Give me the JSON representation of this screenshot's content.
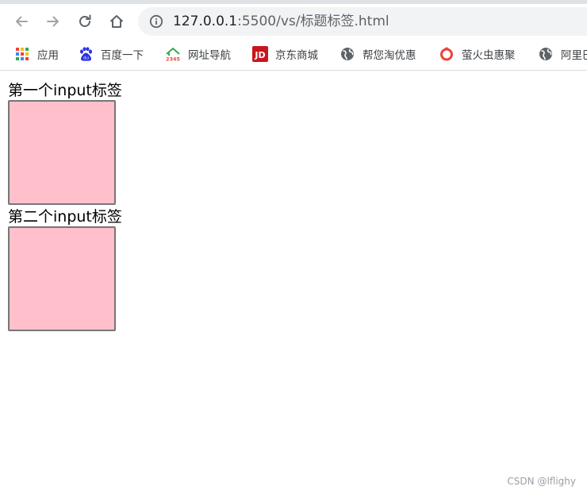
{
  "browser": {
    "url_host": "127.0.0.1",
    "url_path": ":5500/vs/标题标签.html",
    "bookmarks": [
      {
        "label": "应用",
        "icon": "apps-grid-icon"
      },
      {
        "label": "百度一下",
        "icon": "baidu-paw-icon"
      },
      {
        "label": "网址导航",
        "icon": "2345-house-icon"
      },
      {
        "label": "京东商城",
        "icon": "jd-logo-icon"
      },
      {
        "label": "帮您淘优惠",
        "icon": "globe-icon"
      },
      {
        "label": "萤火虫惠聚",
        "icon": "ring-logo-icon"
      },
      {
        "label": "阿里巴",
        "icon": "globe-icon"
      }
    ]
  },
  "page": {
    "label_first": "第一个input标签",
    "label_second": "第二个input标签",
    "input_color": "#ffc0cb"
  },
  "watermark": "CSDN @lflighy"
}
